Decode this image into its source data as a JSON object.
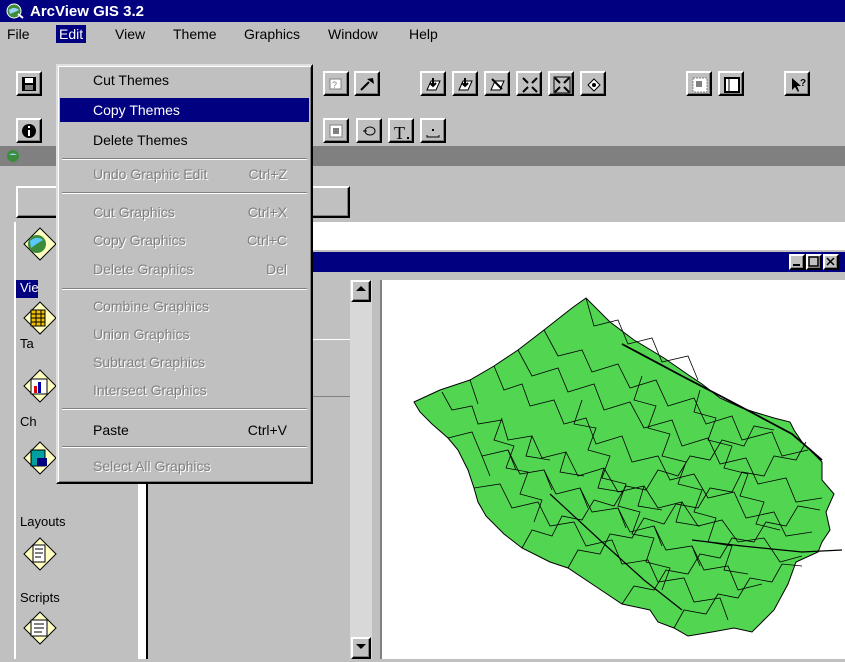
{
  "app": {
    "title": "ArcView GIS 3.2"
  },
  "menubar": [
    "File",
    "Edit",
    "View",
    "Theme",
    "Graphics",
    "Window",
    "Help"
  ],
  "edit_menu": {
    "items": [
      {
        "label": "Cut Themes",
        "shortcut": "",
        "enabled": true
      },
      {
        "label": "Copy Themes",
        "shortcut": "",
        "enabled": true,
        "highlighted": true
      },
      {
        "label": "Delete Themes",
        "shortcut": "",
        "enabled": true
      },
      {
        "label": "Undo Graphic Edit",
        "shortcut": "Ctrl+Z",
        "enabled": false
      },
      {
        "label": "Cut Graphics",
        "shortcut": "Ctrl+X",
        "enabled": false
      },
      {
        "label": "Copy Graphics",
        "shortcut": "Ctrl+C",
        "enabled": false
      },
      {
        "label": "Delete Graphics",
        "shortcut": "Del",
        "enabled": false
      },
      {
        "label": "Combine Graphics",
        "shortcut": "",
        "enabled": false
      },
      {
        "label": "Union Graphics",
        "shortcut": "",
        "enabled": false
      },
      {
        "label": "Subtract Graphics",
        "shortcut": "",
        "enabled": false
      },
      {
        "label": "Intersect Graphics",
        "shortcut": "",
        "enabled": false
      },
      {
        "label": "Paste",
        "shortcut": "Ctrl+V",
        "enabled": true
      },
      {
        "label": "Select All Graphics",
        "shortcut": "",
        "enabled": false
      }
    ]
  },
  "project_panel": {
    "doc_types": [
      {
        "label": "Vie",
        "icon": "views-icon"
      },
      {
        "label": "Ta",
        "icon": "tables-icon"
      },
      {
        "label": "Ch",
        "icon": "charts-icon"
      },
      {
        "label": "Layouts",
        "icon": "layouts-icon"
      },
      {
        "label": "Scripts",
        "icon": "scripts-icon"
      }
    ]
  },
  "map": {
    "fill_color": "#52d652",
    "outline_color": "#000000"
  },
  "colors": {
    "titlebar": "#000080",
    "face": "#c0c0c0",
    "highlight": "#000080"
  }
}
